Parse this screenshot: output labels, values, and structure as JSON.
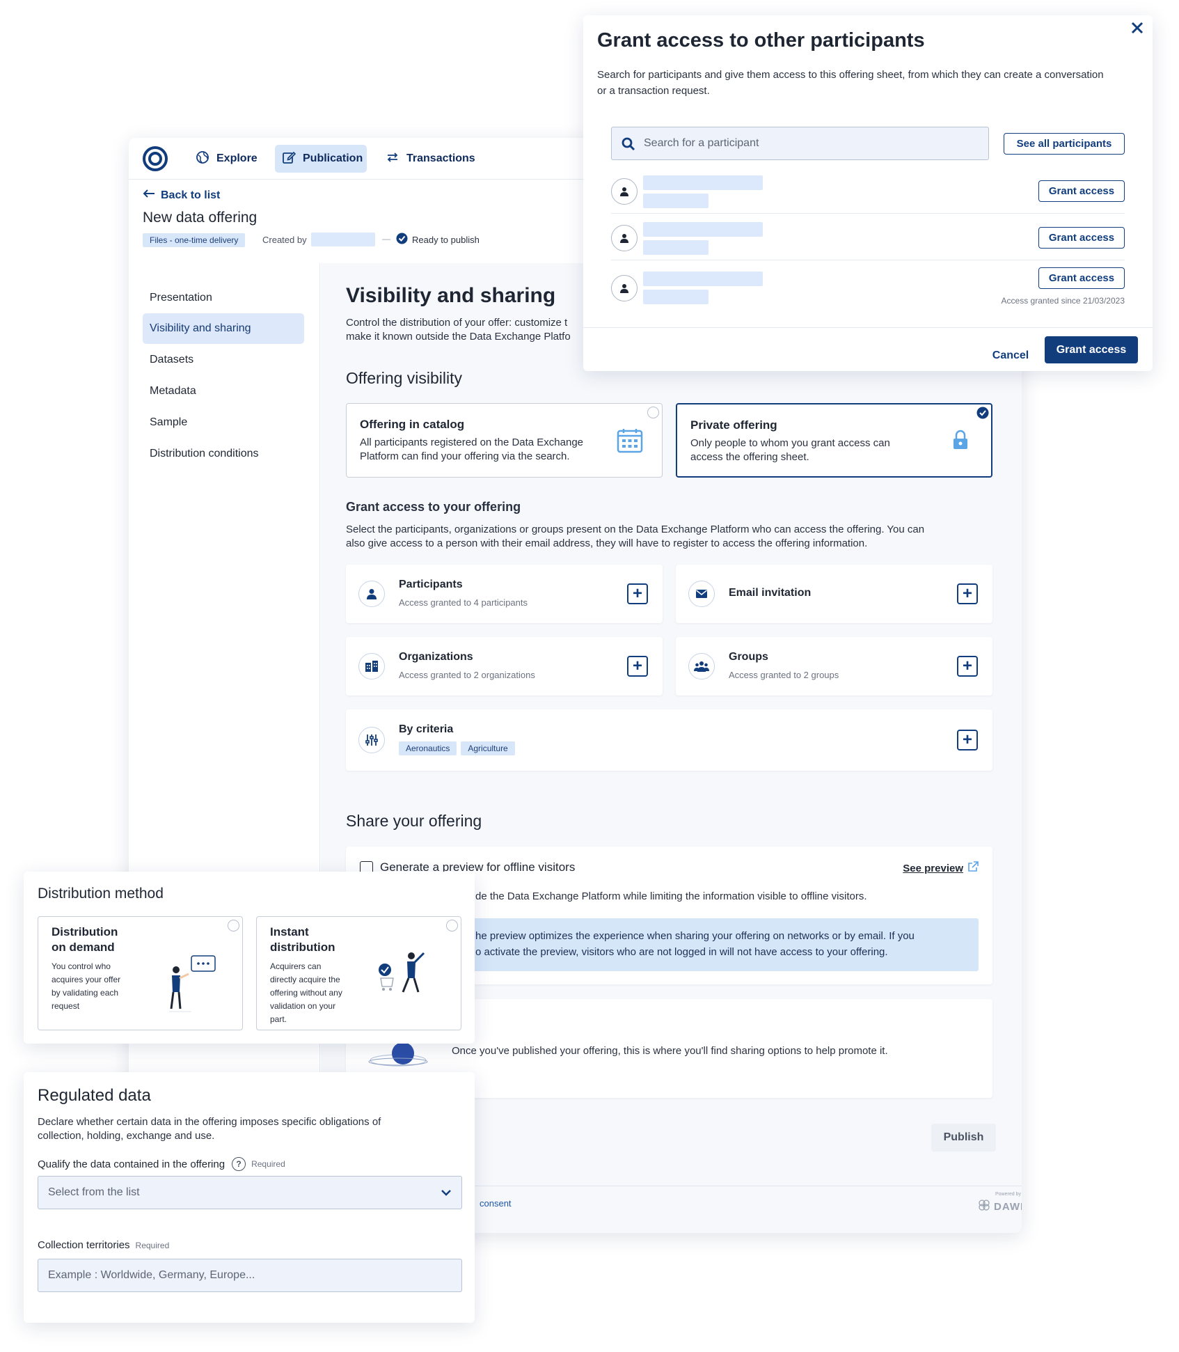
{
  "nav": {
    "explore": "Explore",
    "publication": "Publication",
    "transactions": "Transactions"
  },
  "subheader": {
    "back": "Back to list",
    "title": "New data offering",
    "delivery_tag": "Files - one-time delivery",
    "created_by": "Created by",
    "separator": "—",
    "status": "Ready to publish"
  },
  "sidebar": {
    "items": [
      {
        "label": "Presentation"
      },
      {
        "label": "Visibility and sharing"
      },
      {
        "label": "Datasets"
      },
      {
        "label": "Metadata"
      },
      {
        "label": "Sample"
      },
      {
        "label": "Distribution conditions"
      }
    ]
  },
  "content": {
    "title": "Visibility and sharing",
    "desc_line1": "Control the distribution of your offer: customize t",
    "desc_line2": "make it known outside the Data Exchange Platfo",
    "visibility_title": "Offering visibility",
    "catalog": {
      "title": "Offering in catalog",
      "desc_line1": "All participants registered on the Data Exchange",
      "desc_line2": "Platform can find your offering via the search."
    },
    "private": {
      "title": "Private offering",
      "desc_line1": "Only people to whom you grant access can",
      "desc_line2": "access the offering sheet."
    },
    "grant_title": "Grant access to your offering",
    "grant_desc_line1": "Select the participants, organizations or groups present on the Data Exchange Platform who can access the offering. You can",
    "grant_desc_line2": "also give access to a person with their email address, they will have to register to access the offering information.",
    "tiles": {
      "participants": {
        "title": "Participants",
        "sub": "Access granted to 4 participants"
      },
      "email": {
        "title": "Email invitation"
      },
      "organizations": {
        "title": "Organizations",
        "sub": "Access granted to 2 organizations"
      },
      "groups": {
        "title": "Groups",
        "sub": "Access granted to 2 groups"
      },
      "criteria": {
        "title": "By criteria",
        "tags": [
          "Aeronautics",
          "Agriculture"
        ]
      }
    },
    "share_title": "Share your offering",
    "preview_label": "Generate a preview for offline visitors",
    "see_preview": "See preview",
    "preview_desc": "de the Data Exchange Platform while limiting the information visible to offline visitors.",
    "info_line1": "he preview optimizes the experience when sharing your offering on networks or by email. If you",
    "info_line2": "o activate the preview, visitors who are not logged in will not have access to your offering.",
    "published_text": "Once you've published your offering, this is where you'll find sharing options to help promote it.",
    "publish_btn": "Publish",
    "footer_link": "consent",
    "powered_by": "Powered by",
    "brand": "DAWEX"
  },
  "modal": {
    "title": "Grant access to other participants",
    "desc_line1": "Search for participants and give them access to this offering sheet, from which they can create a conversation",
    "desc_line2": "or a transaction request.",
    "search_placeholder": "Search for a participant",
    "see_all": "See all participants",
    "grant_label": "Grant access",
    "granted_since": "Access granted since 21/03/2023",
    "cancel": "Cancel",
    "grant_primary": "Grant access"
  },
  "distribution": {
    "title": "Distribution method",
    "on_demand": {
      "title_line1": "Distribution",
      "title_line2": "on demand",
      "desc": [
        "You control who",
        "acquires your offer",
        "by validating each",
        "request"
      ]
    },
    "instant": {
      "title_line1": "Instant",
      "title_line2": "distribution",
      "desc": [
        "Acquirers can",
        "directly acquire the",
        "offering without any",
        "validation on your",
        "part."
      ]
    }
  },
  "regulated": {
    "title": "Regulated data",
    "desc_line1": "Declare whether certain data in the offering imposes specific obligations of",
    "desc_line2": "collection, holding, exchange and use.",
    "qualify_label": "Qualify the data contained in the offering",
    "required": "Required",
    "select_placeholder": "Select from the list",
    "territories_label": "Collection territories",
    "territories_placeholder": "Example : Worldwide, Germany, Europe..."
  },
  "colors": {
    "primary": "#123d7d",
    "accent_light": "#d8e6fa",
    "info_bg": "#d6e6f9"
  }
}
